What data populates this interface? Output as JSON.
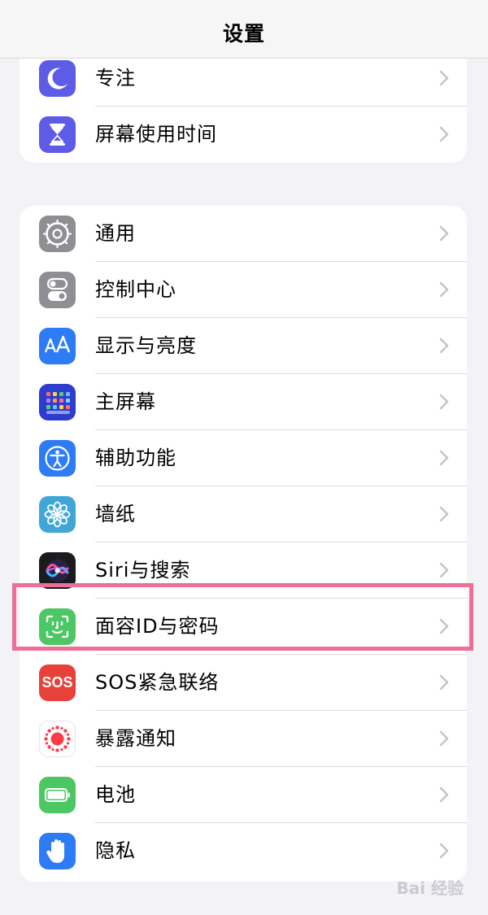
{
  "nav": {
    "title": "设置"
  },
  "group1": {
    "items": [
      {
        "label": "专注",
        "icon": "moon-icon",
        "color": "#5e5ce6"
      },
      {
        "label": "屏幕使用时间",
        "icon": "hourglass-icon",
        "color": "#5e5ce6"
      }
    ]
  },
  "group2": {
    "items": [
      {
        "label": "通用",
        "icon": "gear-icon",
        "color": "#8e8e93"
      },
      {
        "label": "控制中心",
        "icon": "toggle-icon",
        "color": "#8e8e93"
      },
      {
        "label": "显示与亮度",
        "icon": "text-size-icon",
        "color": "#2d7cf6"
      },
      {
        "label": "主屏幕",
        "icon": "app-grid-icon",
        "color": "#2e3ccf"
      },
      {
        "label": "辅助功能",
        "icon": "accessibility-icon",
        "color": "#2d7cf6"
      },
      {
        "label": "墙纸",
        "icon": "flower-icon",
        "color": "#40a6d8"
      },
      {
        "label": "Siri与搜索",
        "icon": "siri-icon",
        "color": "#1b1b1f"
      },
      {
        "label": "面容ID与密码",
        "icon": "face-id-icon",
        "color": "#4cc764"
      },
      {
        "label": "SOS紧急联络",
        "icon": "sos-icon",
        "color": "#e8413a",
        "icon_text": "SOS"
      },
      {
        "label": "暴露通知",
        "icon": "exposure-icon",
        "color": "#ffffff"
      },
      {
        "label": "电池",
        "icon": "battery-icon",
        "color": "#4cc764"
      },
      {
        "label": "隐私",
        "icon": "hand-icon",
        "color": "#2d7cf6"
      }
    ]
  },
  "highlight": {
    "color": "#ee6f96"
  },
  "watermark": {
    "text": "Bai 经验"
  }
}
